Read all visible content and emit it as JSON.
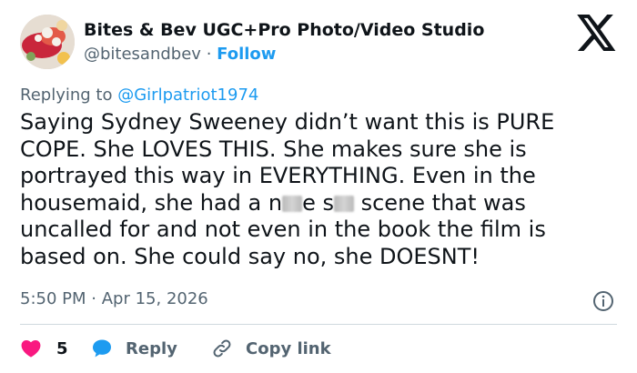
{
  "author": {
    "name": "Bites & Bev UGC+Pro Photo/Video Studio",
    "handle": "@bitesandbev",
    "separator": "·",
    "follow_label": "Follow"
  },
  "reply_context": {
    "prefix": "Replying to",
    "mention": "@Girlpatriot1974"
  },
  "tweet": {
    "line1": "Saying Sydney Sweeney didn’t want this is PURE",
    "line2": "COPE. She LOVES THIS. She makes sure she is",
    "line3": "portrayed this way in EVERYTHING. Even in the",
    "line4_a": "housemaid, she had a n",
    "line4_b": "e s",
    "line4_c": " scene that was",
    "line5": "uncalled for and not even in the book the film is",
    "line6": "based on. She could say no, she DOESNT!"
  },
  "meta": {
    "time": "5:50 PM",
    "separator": "·",
    "date": "Apr 15, 2026"
  },
  "actions": {
    "like_count": "5",
    "reply_label": "Reply",
    "copy_label": "Copy link"
  },
  "icons": {
    "brand": "x-logo-icon",
    "info": "info-icon",
    "like": "heart-icon",
    "reply": "speech-bubble-icon",
    "copy": "link-icon"
  },
  "colors": {
    "accent": "#1d9bf0",
    "like": "#f91880",
    "secondary_text": "#536471",
    "primary_text": "#0f1419",
    "divider": "#cfd9de"
  }
}
